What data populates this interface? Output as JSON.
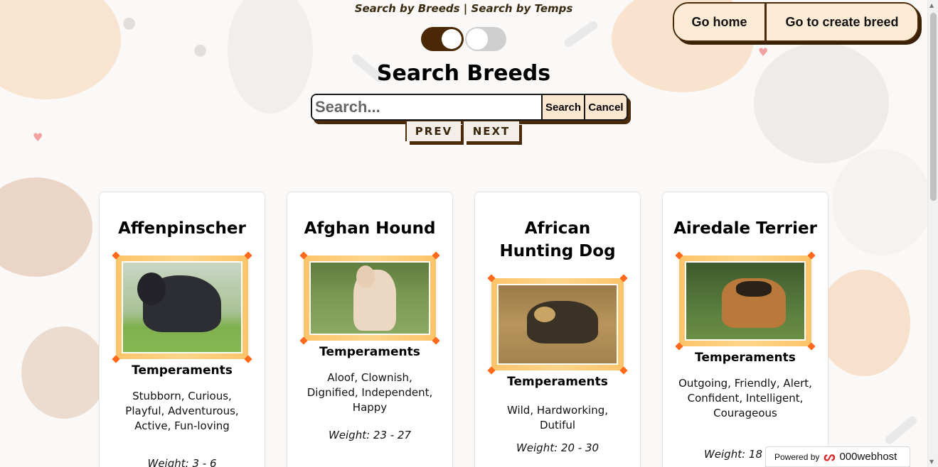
{
  "header": {
    "search_modes": "Search by Breeds | Search by Temps",
    "title": "Search Breeds"
  },
  "nav": {
    "home_label": "Go home",
    "create_label": "Go to create breed"
  },
  "search": {
    "placeholder": "Search...",
    "search_label": "Search",
    "cancel_label": "Cancel"
  },
  "pager": {
    "prev_label": "PREV",
    "next_label": "NEXT"
  },
  "temperaments_heading": "Temperaments",
  "cards": [
    {
      "name": "Affenpinscher",
      "temperaments": "Stubborn, Curious, Playful, Adventurous, Active, Fun-loving",
      "weight": "Weight: 3 - 6"
    },
    {
      "name": "Afghan Hound",
      "temperaments": "Aloof, Clownish, Dignified, Independent, Happy",
      "weight": "Weight: 23 - 27"
    },
    {
      "name": "African Hunting Dog",
      "temperaments": "Wild, Hardworking, Dutiful",
      "weight": "Weight: 20 - 30"
    },
    {
      "name": "Airedale Terrier",
      "temperaments": "Outgoing, Friendly, Alert, Confident, Intelligent, Courageous",
      "weight": "Weight: 18 - 29"
    }
  ],
  "footer": {
    "powered_label": "Powered by",
    "brand": "000webhost"
  },
  "colors": {
    "accent_brown": "#4a2a08",
    "button_fill": "#fdebd6",
    "frame_orange": "#fcc46a"
  }
}
